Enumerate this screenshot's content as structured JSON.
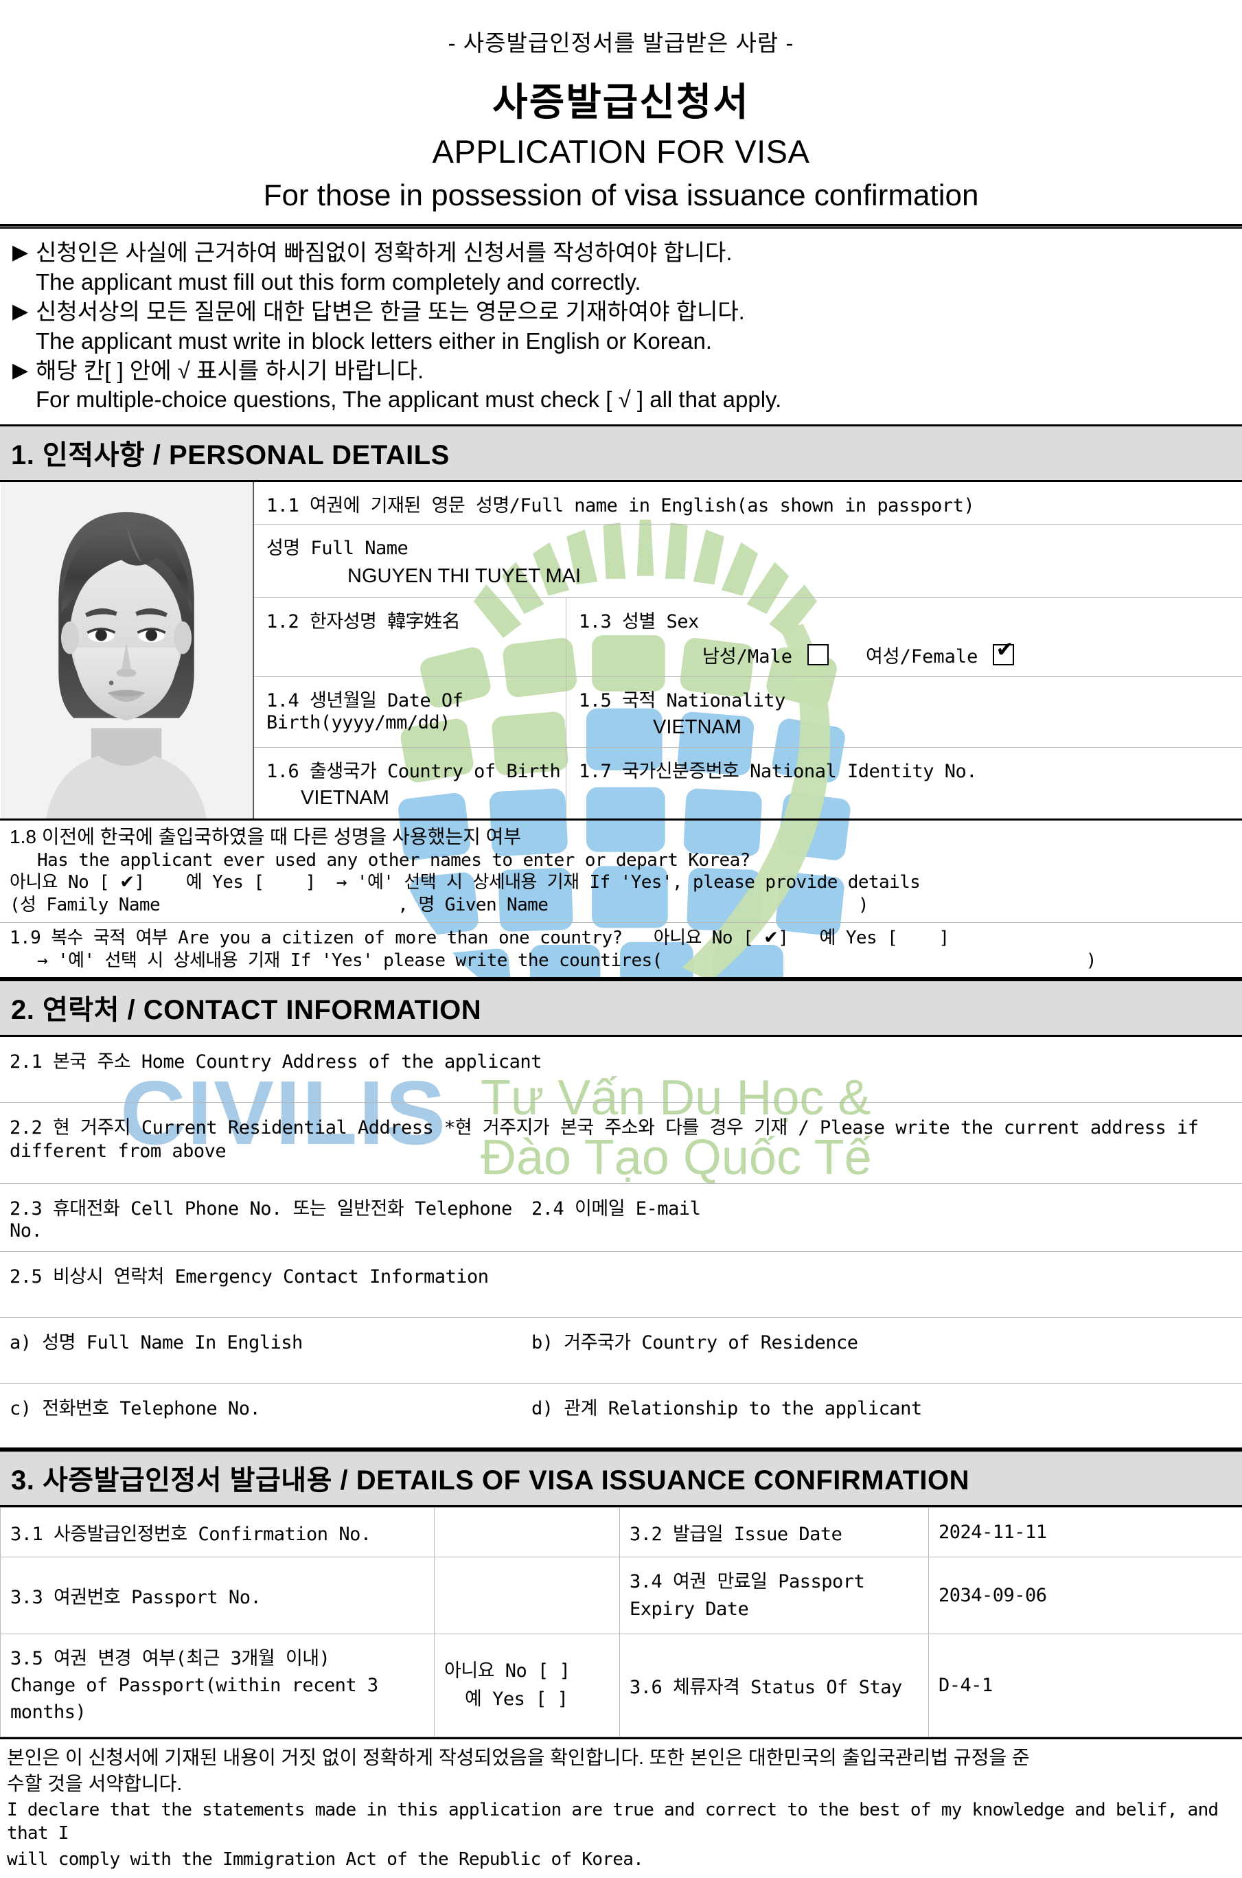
{
  "header": {
    "eyebrow": "- 사증발급인정서를 발급받은 사람 -",
    "title_kr": "사증발급신청서",
    "title_en": "APPLICATION FOR VISA",
    "subtitle": "For those in possession of visa issuance confirmation"
  },
  "instructions": [
    {
      "bullet": "▶",
      "kr": "신청인은 사실에 근거하여 빠짐없이 정확하게 신청서를 작성하여야 합니다.",
      "en": "The applicant must fill out this form completely and correctly."
    },
    {
      "bullet": "▶",
      "kr": "신청서상의 모든 질문에 대한 답변은 한글 또는 영문으로 기재하여야 합니다.",
      "en": "The applicant must write in block letters either in English or Korean."
    },
    {
      "bullet": "▶",
      "kr": "해당 칸[ ] 안에 √ 표시를 하시기 바랍니다.",
      "en": "For multiple-choice questions, The applicant must check [ √ ] all that apply."
    }
  ],
  "section1": {
    "bar": "1. 인적사항 / PERSONAL DETAILS",
    "f11_label": "1.1 여권에 기재된 영문 성명/Full name in English(as shown in passport)",
    "fullname_label": "성명 Full Name",
    "fullname_value": "NGUYEN THI TUYET MAI",
    "f12_label": "1.2 한자성명 韓字姓名",
    "f12_value": "",
    "f13_label": "1.3 성별 Sex",
    "male_label": "남성/Male",
    "male_checked": false,
    "female_label": "여성/Female",
    "female_checked": true,
    "f14_label": "1.4 생년월일 Date Of Birth(yyyy/mm/dd)",
    "f14_value": "",
    "f15_label": "1.5 국적 Nationality",
    "f15_value": "VIETNAM",
    "f16_label": "1.6 출생국가 Country of Birth",
    "f16_value": "VIETNAM",
    "f17_label": "1.7 국가신분증번호 National Identity No.",
    "f17_value": "",
    "f18": {
      "line_kr": "1.8 이전에 한국에 출입국하였을 때 다른 성명을 사용했는지 여부",
      "line_en": "Has the applicant ever used any other names to enter or depart Korea?",
      "no_label": "아니요 No",
      "no_checked": true,
      "yes_label": "예 Yes",
      "yes_checked": false,
      "detail_hint": "→ '예' 선택 시 상세내용 기재 If 'Yes', please provide details",
      "family_name_label": "(성 Family Name",
      "given_name_label": ", 명 Given Name",
      "close_paren": ")"
    },
    "f19": {
      "line": "1.9 복수 국적 여부 Are you a citizen of more than one country?",
      "no_label": "아니요 No",
      "no_checked": true,
      "yes_label": "예 Yes",
      "yes_checked": false,
      "detail_hint": "→ '예' 선택 시 상세내용 기재 If 'Yes' please write the countires(",
      "close_paren": ")"
    }
  },
  "section2": {
    "bar": "2. 연락처 / CONTACT INFORMATION",
    "f21_label": "2.1 본국 주소 Home Country Address of the applicant",
    "f21_value": "",
    "f22_label": "2.2 현 거주지 Current Residential Address *현 거주지가 본국 주소와 다를 경우 기재 / Please write the current address if",
    "f22_label_line2": "different from above",
    "f22_value": "",
    "f23_label": "2.3 휴대전화 Cell Phone No. 또는 일반전화 Telephone No.",
    "f23_value": "",
    "f24_label": "2.4 이메일 E-mail",
    "f24_value": "",
    "f25_label": "2.5 비상시 연락처 Emergency Contact Information",
    "ec_a_label": "a) 성명 Full Name In English",
    "ec_a_value": "",
    "ec_b_label": "b) 거주국가 Country of Residence",
    "ec_b_value": "",
    "ec_c_label": "c) 전화번호 Telephone No.",
    "ec_c_value": "",
    "ec_d_label": "d) 관계 Relationship to the applicant",
    "ec_d_value": ""
  },
  "section3": {
    "bar": "3. 사증발급인정서 발급내용 / DETAILS OF VISA ISSUANCE CONFIRMATION",
    "f31_label": "3.1 사증발급인정번호 Confirmation No.",
    "f31_value": "",
    "f32_label": "3.2 발급일 Issue Date",
    "f32_value": "2024-11-11",
    "f33_label": "3.3 여권번호 Passport No.",
    "f33_value": "",
    "f34_label": "3.4 여권 만료일 Passport Expiry Date",
    "f34_value": "2034-09-06",
    "f35_label_line1": "3.5 여권 변경 여부(최근 3개월 이내)",
    "f35_label_line2": "Change of Passport(within recent 3 months)",
    "f35_no_label": "아니요 No",
    "f35_no_checked": false,
    "f35_yes_label": "예 Yes",
    "f35_yes_checked": false,
    "f36_label": "3.6 체류자격 Status Of Stay",
    "f36_value": "D-4-1"
  },
  "declaration": {
    "kr_line1": "본인은 이 신청서에 기재된 내용이 거짓 없이 정확하게 작성되었음을 확인합니다. 또한 본인은 대한민국의 출입국관리법 규정을 준",
    "kr_line2": "수할 것을 서약합니다.",
    "en_line1": "I declare that the statements made in this application are true and correct to the best of my knowledge and belif, and that I",
    "en_line2": "will comply with the Immigration Act of the Republic of Korea."
  },
  "watermark": {
    "brand": "CIVILIS",
    "tagline_line1": "Tư Vấn Du Học &",
    "tagline_line2": "Đào Tạo Quốc Tế",
    "brand_color": "#a8cbe8",
    "tagline_color": "#bcd9a6",
    "globe_green": "#c6dfb0",
    "globe_blue": "#9ccdec"
  },
  "photo": {
    "alt": "applicant-passport-photo"
  }
}
